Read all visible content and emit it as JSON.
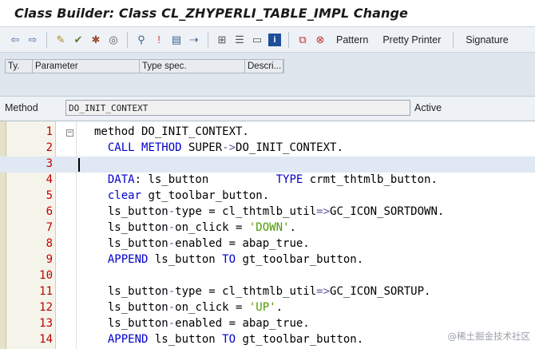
{
  "window": {
    "title": "Class Builder: Class CL_ZHYPERLI_TABLE_IMPL Change"
  },
  "toolbar": {
    "icons": [
      "back-arrow-icon",
      "forward-arrow-icon",
      "toggle-display-change-icon",
      "check-icon",
      "activate-icon",
      "test-icon",
      "where-used-icon",
      "other-object-icon",
      "display-object-list-icon",
      "navigation-window-icon",
      "hierarchy-icon",
      "print-icon",
      "help-icon",
      "info-icon",
      "insert-statement-icon",
      "delete-icon"
    ],
    "pattern_label": "Pattern",
    "pretty_printer_label": "Pretty Printer",
    "signature_label": "Signature"
  },
  "parameters": {
    "columns": [
      "Ty.",
      "Parameter",
      "Type spec.",
      "Descri..."
    ]
  },
  "method": {
    "label": "Method",
    "name": "DO_INIT_CONTEXT",
    "status": "Active"
  },
  "editor": {
    "lines": [
      {
        "num": "1",
        "fold": "⊟",
        "tokens": [
          {
            "t": "method DO_INIT_CONTEXT.",
            "c": ""
          }
        ]
      },
      {
        "num": "2",
        "tokens": [
          {
            "t": "  ",
            "c": ""
          },
          {
            "t": "CALL",
            "c": "kw"
          },
          {
            "t": " ",
            "c": ""
          },
          {
            "t": "METHOD",
            "c": "kw"
          },
          {
            "t": " SUPER",
            "c": ""
          },
          {
            "t": "->",
            "c": "op"
          },
          {
            "t": "DO_INIT_CONTEXT.",
            "c": ""
          }
        ]
      },
      {
        "num": "3",
        "current": true,
        "tokens": []
      },
      {
        "num": "4",
        "tokens": [
          {
            "t": "  ",
            "c": ""
          },
          {
            "t": "DATA",
            "c": "kw"
          },
          {
            "t": ": ls_button          ",
            "c": ""
          },
          {
            "t": "TYPE",
            "c": "kw"
          },
          {
            "t": " crmt_thtmlb_button.",
            "c": ""
          }
        ]
      },
      {
        "num": "5",
        "tokens": [
          {
            "t": "  ",
            "c": ""
          },
          {
            "t": "clear",
            "c": "kw"
          },
          {
            "t": " gt_toolbar_button.",
            "c": ""
          }
        ]
      },
      {
        "num": "6",
        "tokens": [
          {
            "t": "  ls_button",
            "c": ""
          },
          {
            "t": "-",
            "c": "op"
          },
          {
            "t": "type = cl_thtmlb_util",
            "c": ""
          },
          {
            "t": "=>",
            "c": "op"
          },
          {
            "t": "GC_ICON_SORTDOWN.",
            "c": ""
          }
        ]
      },
      {
        "num": "7",
        "tokens": [
          {
            "t": "  ls_button",
            "c": ""
          },
          {
            "t": "-",
            "c": "op"
          },
          {
            "t": "on_click = ",
            "c": ""
          },
          {
            "t": "'DOWN'",
            "c": "str"
          },
          {
            "t": ".",
            "c": ""
          }
        ]
      },
      {
        "num": "8",
        "tokens": [
          {
            "t": "  ls_button",
            "c": ""
          },
          {
            "t": "-",
            "c": "op"
          },
          {
            "t": "enabled = abap_true.",
            "c": ""
          }
        ]
      },
      {
        "num": "9",
        "tokens": [
          {
            "t": "  ",
            "c": ""
          },
          {
            "t": "APPEND",
            "c": "kw"
          },
          {
            "t": " ls_button ",
            "c": ""
          },
          {
            "t": "TO",
            "c": "kw"
          },
          {
            "t": " gt_toolbar_button.",
            "c": ""
          }
        ]
      },
      {
        "num": "10",
        "tokens": []
      },
      {
        "num": "11",
        "tokens": [
          {
            "t": "  ls_button",
            "c": ""
          },
          {
            "t": "-",
            "c": "op"
          },
          {
            "t": "type = cl_thtmlb_util",
            "c": ""
          },
          {
            "t": "=>",
            "c": "op"
          },
          {
            "t": "GC_ICON_SORTUP.",
            "c": ""
          }
        ]
      },
      {
        "num": "12",
        "tokens": [
          {
            "t": "  ls_button",
            "c": ""
          },
          {
            "t": "-",
            "c": "op"
          },
          {
            "t": "on_click = ",
            "c": ""
          },
          {
            "t": "'UP'",
            "c": "str"
          },
          {
            "t": ".",
            "c": ""
          }
        ]
      },
      {
        "num": "13",
        "tokens": [
          {
            "t": "  ls_button",
            "c": ""
          },
          {
            "t": "-",
            "c": "op"
          },
          {
            "t": "enabled = abap_true.",
            "c": ""
          }
        ]
      },
      {
        "num": "14",
        "tokens": [
          {
            "t": "  ",
            "c": ""
          },
          {
            "t": "APPEND",
            "c": "kw"
          },
          {
            "t": " ls_button ",
            "c": ""
          },
          {
            "t": "TO",
            "c": "kw"
          },
          {
            "t": " gt_toolbar_button.",
            "c": ""
          }
        ]
      }
    ]
  },
  "watermark": "@稀土掘金技术社区"
}
